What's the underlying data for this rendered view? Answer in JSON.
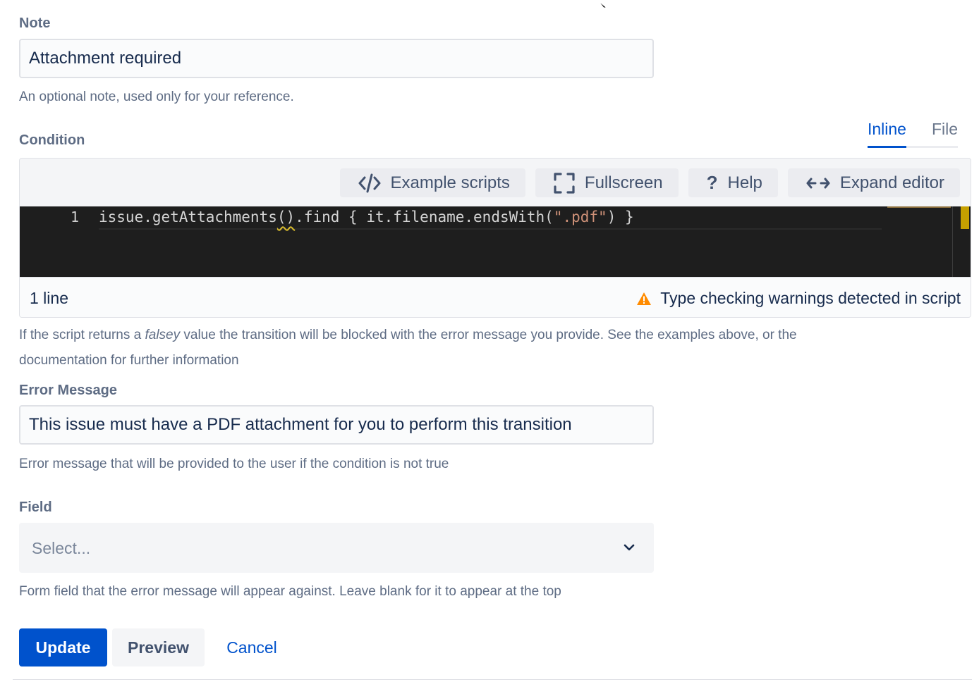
{
  "note": {
    "label": "Note",
    "value": "Attachment required",
    "help": "An optional note, used only for your reference."
  },
  "condition": {
    "label": "Condition",
    "tabs": [
      {
        "label": "Inline",
        "active": true
      },
      {
        "label": "File",
        "active": false
      }
    ],
    "toolbar": {
      "example_scripts": "Example scripts",
      "fullscreen": "Fullscreen",
      "help": "Help",
      "expand_editor": "Expand editor"
    },
    "code": {
      "line_number": "1",
      "part1": "issue.getAttachments",
      "part2": "()",
      "part3": ".find { it.filename.endsWith(",
      "str": "\".pdf\"",
      "part4": ") }"
    },
    "status": {
      "lines": "1 line",
      "warning": "Type checking warnings detected in script"
    },
    "help_prefix": "If the script returns a ",
    "help_em": "falsey",
    "help_line1_rest": " value the transition will be blocked with the error message you provide. See the examples above, or the",
    "help_line2": "documentation for further information"
  },
  "error_message": {
    "label": "Error Message",
    "value": "This issue must have a PDF attachment for you to perform this transition",
    "help": "Error message that will be provided to the user if the condition is not true"
  },
  "field": {
    "label": "Field",
    "placeholder": "Select...",
    "help": "Form field that the error message will appear against. Leave blank for it to appear at the top"
  },
  "actions": {
    "update": "Update",
    "preview": "Preview",
    "cancel": "Cancel"
  },
  "colors": {
    "primary": "#0052cc",
    "warning": "#ff8b00",
    "editor_bg": "#1e1e1e"
  }
}
